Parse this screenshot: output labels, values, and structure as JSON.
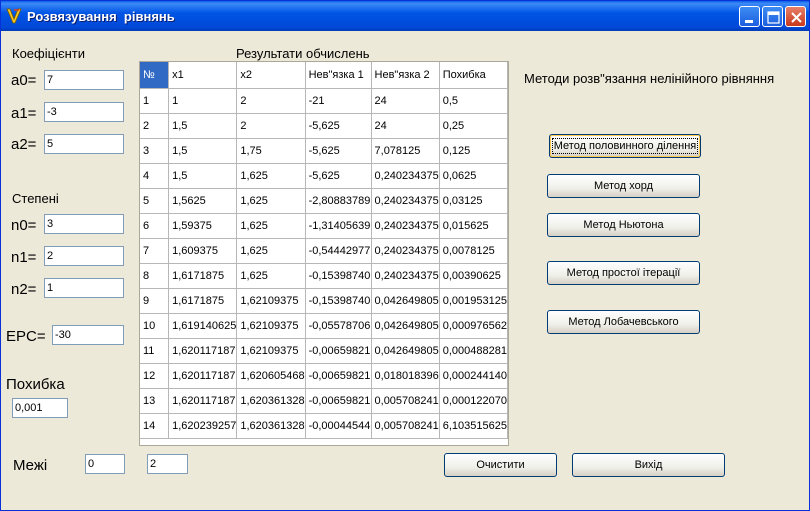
{
  "window": {
    "title": "Розвязування  рівнянь"
  },
  "coefficients": {
    "heading": "Коефіцієнти",
    "a0_label": "а0=",
    "a0_value": "7",
    "a1_label": "а1=",
    "a1_value": "-3",
    "a2_label": "а2=",
    "a2_value": "5"
  },
  "powers": {
    "heading": "Степені",
    "n0_label": "n0=",
    "n0_value": "3",
    "n1_label": "n1=",
    "n1_value": "2",
    "n2_label": "n2=",
    "n2_value": "1"
  },
  "eps": {
    "label": "EPC=",
    "value": "-30"
  },
  "error": {
    "label": "Похибка",
    "value": "0,001"
  },
  "bounds": {
    "label": "Межі",
    "low": "0",
    "high": "2"
  },
  "results": {
    "heading": "Результати обчислень",
    "columns": [
      "№",
      "x1",
      "x2",
      "Нев\"язка 1",
      "Нев\"язка 2",
      "Похибка"
    ],
    "rows": [
      [
        "1",
        "1",
        "2",
        "-21",
        "24",
        "0,5"
      ],
      [
        "2",
        "1,5",
        "2",
        "-5,625",
        "24",
        "0,25"
      ],
      [
        "3",
        "1,5",
        "1,75",
        "-5,625",
        "7,078125",
        "0,125"
      ],
      [
        "4",
        "1,5",
        "1,625",
        "-5,625",
        "0,240234375",
        "0,0625"
      ],
      [
        "5",
        "1,5625",
        "1,625",
        "-2,80883789",
        "0,240234375",
        "0,03125"
      ],
      [
        "6",
        "1,59375",
        "1,625",
        "-1,31405639",
        "0,240234375",
        "0,015625"
      ],
      [
        "7",
        "1,609375",
        "1,625",
        "-0,54442977",
        "0,240234375",
        "0,0078125"
      ],
      [
        "8",
        "1,6171875",
        "1,625",
        "-0,15398740",
        "0,240234375",
        "0,00390625"
      ],
      [
        "9",
        "1,6171875",
        "1,62109375",
        "-0,15398740",
        "0,042649805",
        "0,001953125"
      ],
      [
        "10",
        "1,619140625",
        "1,62109375",
        "-0,05578706",
        "0,042649805",
        "0,000976562"
      ],
      [
        "11",
        "1,620117187",
        "1,62109375",
        "-0,00659821",
        "0,042649805",
        "0,000488281"
      ],
      [
        "12",
        "1,620117187",
        "1,620605468",
        "-0,00659821",
        "0,018018396",
        "0,000244140"
      ],
      [
        "13",
        "1,620117187",
        "1,620361328",
        "-0,00659821",
        "0,005708241",
        "0,000122070"
      ],
      [
        "14",
        "1,620239257",
        "1,620361328",
        "-0,00044544",
        "0,005708241",
        "6,103515625"
      ]
    ]
  },
  "methods": {
    "heading": "Методи розв\"язання нелінійного рівняння",
    "bisection": "Метод половинного ділення",
    "chords": "Метод хорд",
    "newton": "Метод Ньютона",
    "iteration": "Метод простої ітерації",
    "lobachevsky": "Метод Лобачевського"
  },
  "actions": {
    "clear": "Очистити",
    "exit": "Вихід"
  }
}
